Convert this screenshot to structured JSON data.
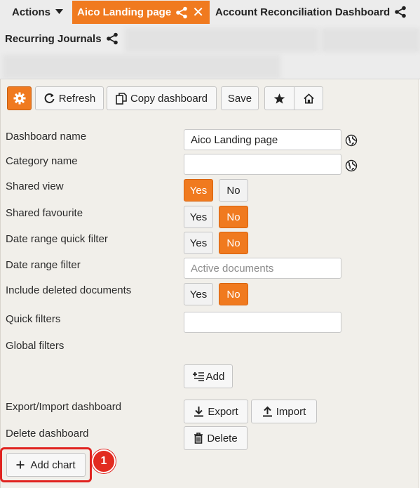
{
  "tabs": {
    "actions_label": "Actions",
    "active_label": "Aico Landing page",
    "account_recon_label": "Account Reconciliation Dashboard",
    "recurring_label": "Recurring Journals"
  },
  "toolbar": {
    "refresh_label": "Refresh",
    "copy_label": "Copy dashboard",
    "save_label": "Save"
  },
  "form": {
    "dashboard_name_label": "Dashboard name",
    "dashboard_name_value": "Aico Landing page",
    "category_name_label": "Category name",
    "category_name_value": "",
    "shared_view_label": "Shared view",
    "shared_favourite_label": "Shared favourite",
    "date_range_quick_label": "Date range quick filter",
    "date_range_filter_label": "Date range filter",
    "date_range_placeholder": "Active documents",
    "include_deleted_label": "Include deleted documents",
    "quick_filters_label": "Quick filters",
    "quick_filters_value": "",
    "global_filters_label": "Global filters",
    "add_label": "Add",
    "export_import_label": "Export/Import dashboard",
    "export_label": "Export",
    "import_label": "Import",
    "delete_dashboard_label": "Delete dashboard",
    "delete_label": "Delete",
    "yes": "Yes",
    "no": "No",
    "shared_view_selected": "Yes",
    "shared_favourite_selected": "No",
    "date_range_quick_selected": "No",
    "include_deleted_selected": "No"
  },
  "add_chart_label": "Add chart",
  "callout_number": "1",
  "colors": {
    "accent": "#f07a1f",
    "panel_bg": "#f1efea",
    "highlight": "#e0231f"
  },
  "icons": [
    "caret-down-icon",
    "share-icon",
    "close-icon",
    "gear-icon",
    "refresh-icon",
    "copy-icon",
    "star-icon",
    "home-icon",
    "globe-icon",
    "add-filter-icon",
    "download-icon",
    "upload-icon",
    "trash-icon",
    "plus-icon"
  ]
}
